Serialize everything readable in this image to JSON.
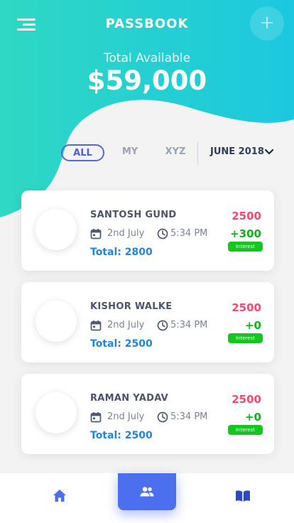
{
  "header": {
    "title": "PASSBOOK",
    "add_symbol": "+",
    "balance_label": "Total Available",
    "balance_amount": "$59,000"
  },
  "filters": {
    "tabs": [
      "ALL",
      "MY",
      "XYZ"
    ],
    "active": "ALL",
    "month": "JUNE 2018"
  },
  "entries": [
    {
      "name": "SANTOSH GUND",
      "date": "2nd July",
      "time": "5:34 PM",
      "total": "Total: 2800",
      "amount": "2500",
      "interest": "+300",
      "badge": "Interest"
    },
    {
      "name": "KISHOR WALKE",
      "date": "2nd July",
      "time": "5:34 PM",
      "total": "Total: 2500",
      "amount": "2500",
      "interest": "+0",
      "badge": "Interest"
    },
    {
      "name": "RAMAN YADAV",
      "date": "2nd July",
      "time": "5:34 PM",
      "total": "Total: 2500",
      "amount": "2500",
      "interest": "+0",
      "badge": "Interest"
    }
  ],
  "nav": {
    "items": [
      "home-icon",
      "people-icon",
      "book-icon"
    ],
    "active": "people-icon"
  },
  "colors": {
    "gradient_start": "#2fd6c4",
    "gradient_end": "#1dc7e2",
    "accent": "#4c6ff0",
    "amount": "#f04d6e",
    "interest": "#12b01e",
    "total": "#1f86e0"
  }
}
